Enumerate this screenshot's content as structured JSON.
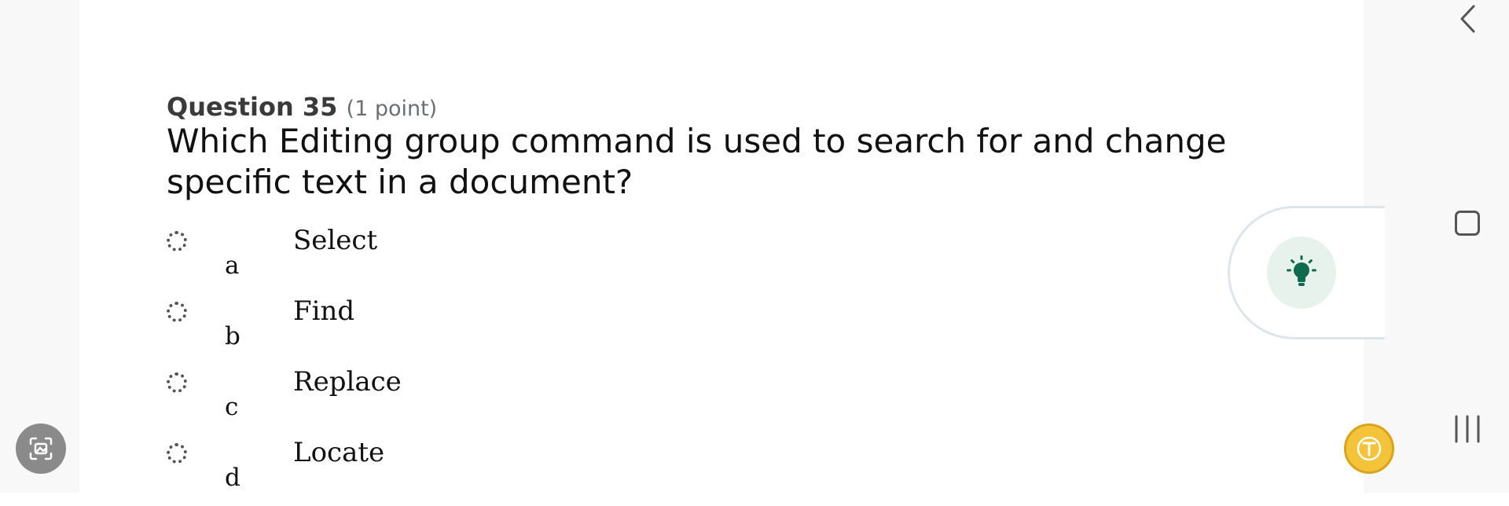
{
  "question": {
    "number_label": "Question 35",
    "points_label": "(1 point)",
    "text": "Which Editing group command is used to search for and change specific text in a document?"
  },
  "options": [
    {
      "letter": "a",
      "text": "Select"
    },
    {
      "letter": "b",
      "text": "Find"
    },
    {
      "letter": "c",
      "text": "Replace"
    },
    {
      "letter": "d",
      "text": "Locate"
    }
  ],
  "icons": {
    "hint": "lightbulb-icon",
    "left_fab": "image-scan-icon",
    "right_fab": "text-t-icon",
    "nav_back": "chevron-left-icon",
    "nav_home": "home-square-icon",
    "nav_recents": "recents-icon"
  },
  "colors": {
    "hint_green": "#0f6b4f",
    "hint_bg": "#e8f2ec",
    "fab_yellow": "#f3c43a"
  }
}
